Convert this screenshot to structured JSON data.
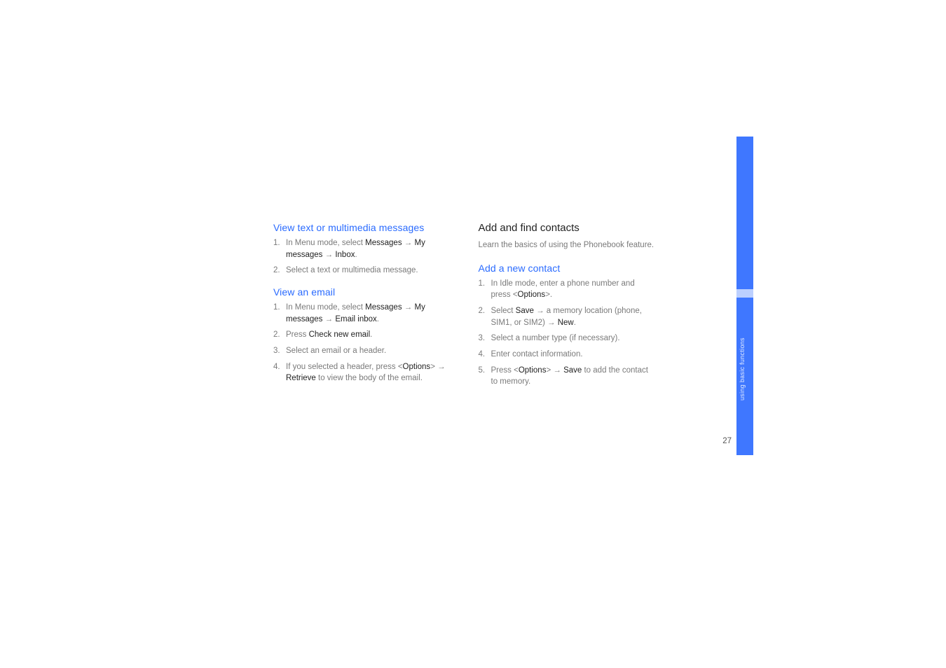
{
  "side": {
    "label": "using basic functions"
  },
  "page_number": "27",
  "left": {
    "h1": "View text or multimedia messages",
    "s1": [
      {
        "pre": "In Menu mode, select ",
        "b1": "Messages",
        "mid1": " ",
        "arr1": "→",
        "mid2": " ",
        "b2": "My messages",
        "mid3": " ",
        "arr2": "→",
        "mid4": " ",
        "b3": "Inbox",
        "post": "."
      },
      {
        "text": "Select a text or multimedia message."
      }
    ],
    "h2": "View an email",
    "s2": [
      {
        "pre": "In Menu mode, select ",
        "b1": "Messages",
        "mid1": " ",
        "arr1": "→",
        "mid2": " ",
        "b2": "My messages",
        "mid3": " ",
        "arr2": "→",
        "mid4": " ",
        "b3": "Email inbox",
        "post": "."
      },
      {
        "pre": "Press ",
        "b1": "Check new email",
        "post": "."
      },
      {
        "text": "Select an email or a header."
      },
      {
        "pre": "If you selected a header, press <",
        "b1": "Options",
        "mid1": "> ",
        "arr1": "→",
        "mid2": " ",
        "b2": "Retrieve",
        "post": " to view the body of the email."
      }
    ]
  },
  "right": {
    "h1": "Add and find contacts",
    "lead": "Learn the basics of using the Phonebook feature.",
    "h2": "Add a new contact",
    "s1": [
      {
        "pre": "In Idle mode, enter a phone number and press <",
        "b1": "Options",
        "post": ">."
      },
      {
        "pre": "Select ",
        "b1": "Save",
        "mid1": " ",
        "arr1": "→",
        "mid2": " a memory location (phone, SIM1, or SIM2) ",
        "arr2": "→",
        "mid3": " ",
        "b2": "New",
        "post": "."
      },
      {
        "text": "Select a number type (if necessary)."
      },
      {
        "text": "Enter contact information."
      },
      {
        "pre": "Press <",
        "b1": "Options",
        "mid1": "> ",
        "arr1": "→",
        "mid2": " ",
        "b2": "Save",
        "post": " to add the contact to memory."
      }
    ]
  }
}
